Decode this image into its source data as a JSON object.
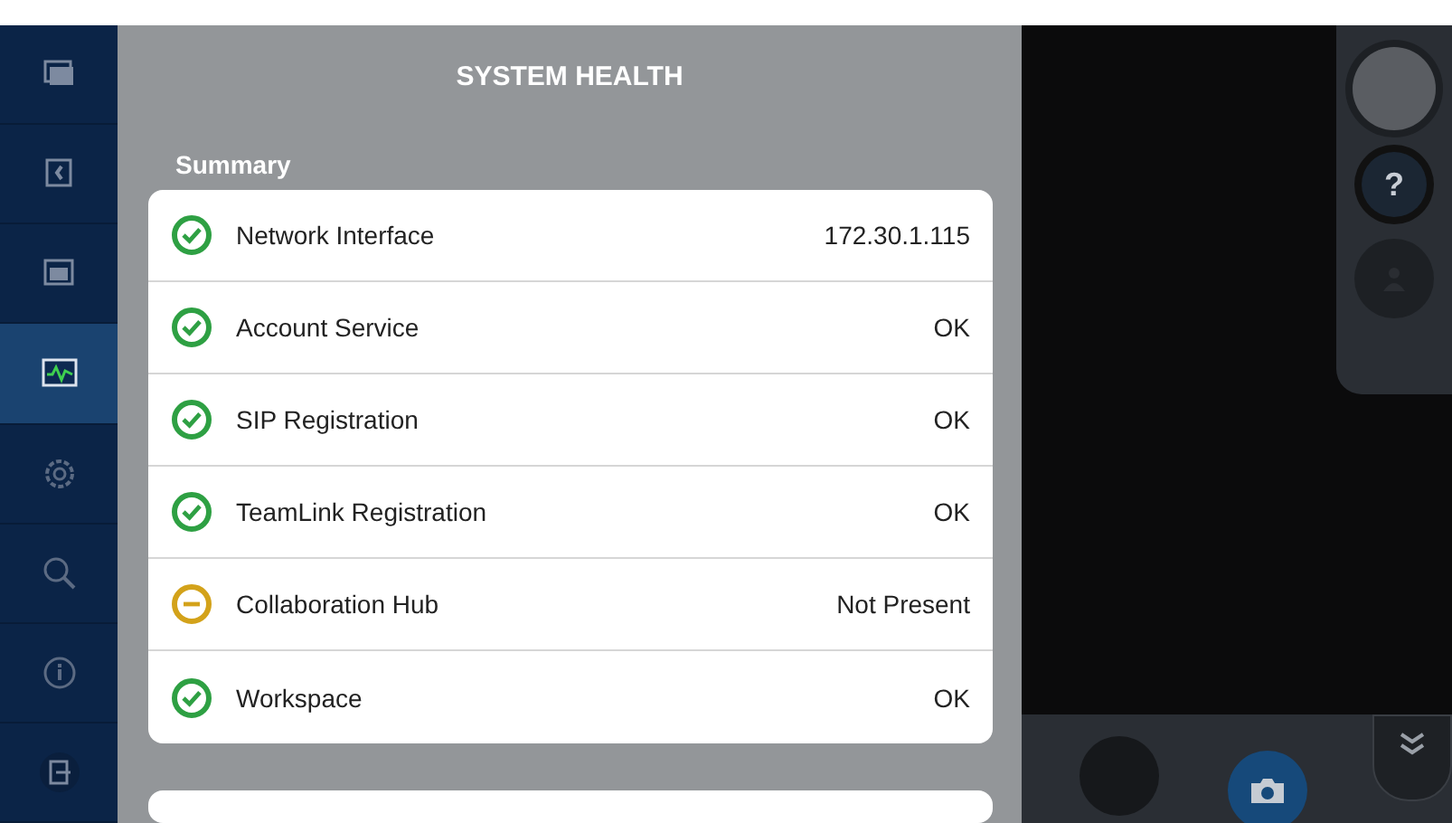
{
  "sidebar": {
    "items": [
      {
        "kind": "contact",
        "selected": false
      },
      {
        "kind": "book",
        "selected": false
      },
      {
        "kind": "image",
        "selected": false
      },
      {
        "kind": "health",
        "selected": true
      },
      {
        "kind": "settings",
        "selected": false
      },
      {
        "kind": "search",
        "selected": false
      },
      {
        "kind": "info",
        "selected": false
      },
      {
        "kind": "exit",
        "selected": false
      }
    ]
  },
  "panel": {
    "title": "SYSTEM HEALTH",
    "section": "Summary",
    "rows": [
      {
        "label": "Network Interface",
        "value": "172.30.1.115",
        "kind": "ok"
      },
      {
        "label": "Account Service",
        "value": "OK",
        "kind": "ok"
      },
      {
        "label": "SIP Registration",
        "value": "OK",
        "kind": "ok"
      },
      {
        "label": "TeamLink Registration",
        "value": "OK",
        "kind": "ok"
      },
      {
        "label": "Collaboration Hub",
        "value": "Not Present",
        "kind": "warning"
      },
      {
        "label": "Workspace",
        "value": "OK",
        "kind": "ok"
      }
    ]
  },
  "camera": {
    "help_button": "?"
  }
}
